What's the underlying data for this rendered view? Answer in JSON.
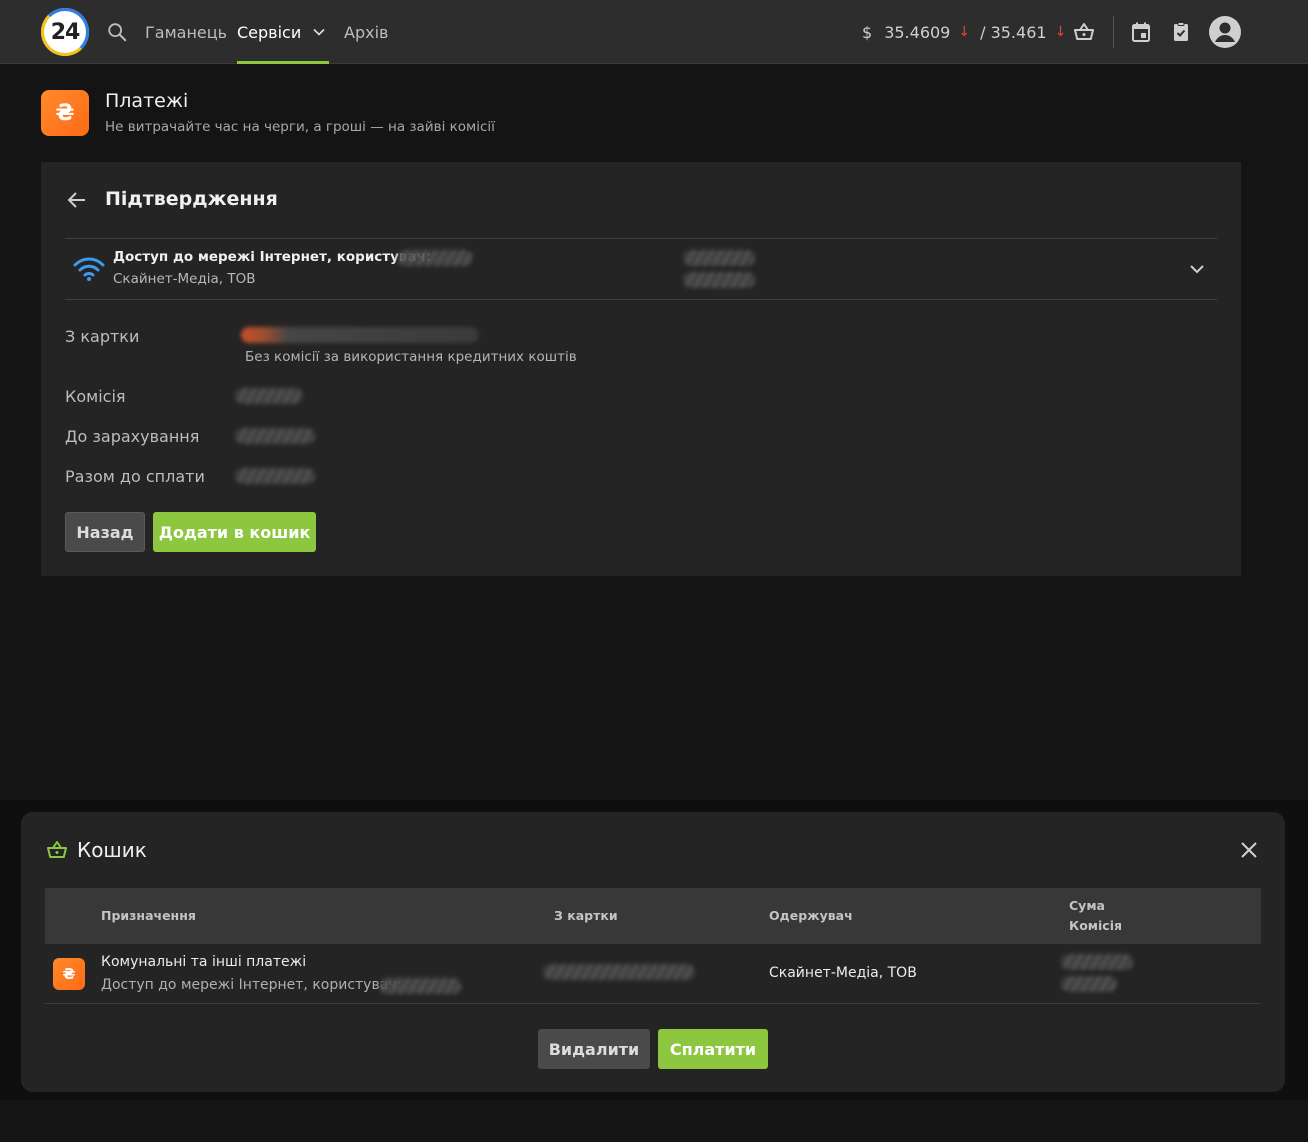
{
  "topbar": {
    "logo_text": "24",
    "nav": [
      {
        "label": "Гаманець"
      },
      {
        "label": "Сервіси"
      },
      {
        "label": "Архів"
      }
    ],
    "rate_currency": "$",
    "rate_buy": "35.4609",
    "rate_sell": "/ 35.461",
    "rate_arrow": "↓"
  },
  "header": {
    "logo_glyph": "₴",
    "title": "Платежі",
    "subtitle": "Не витрачайте час на черги, а гроші — на зайві комісії"
  },
  "confirmation": {
    "title": "Підтвердження",
    "payee_title": "Доступ до мережі Інтернет, користувач:",
    "payee_company": "Скайнет-Медіа, ТОВ",
    "from_card_label": "З картки",
    "from_card_note": "Без комісії за використання кредитних коштів",
    "commission_label": "Комісія",
    "to_credit_label": "До зарахування",
    "total_label": "Разом до сплати",
    "back_button": "Назад",
    "add_to_cart_button": "Додати в кошик"
  },
  "cart": {
    "title": "Кошик",
    "columns": {
      "purpose": "Призначення",
      "from_card": "З картки",
      "recipient": "Одержувач",
      "amount": "Сума",
      "commission": "Комісія"
    },
    "rows": [
      {
        "logo_glyph": "₴",
        "purpose": "Комунальні та інші платежі",
        "purpose_sub": "Доступ до мережі Інтернет, користувач:",
        "recipient": "Скайнет-Медіа, ТОВ"
      }
    ],
    "delete_button": "Видалити",
    "pay_button": "Сплатити"
  },
  "colors": {
    "accent_green": "#8dc63f",
    "service_orange": "#ff7a20",
    "rate_down_red": "#e0443e"
  }
}
